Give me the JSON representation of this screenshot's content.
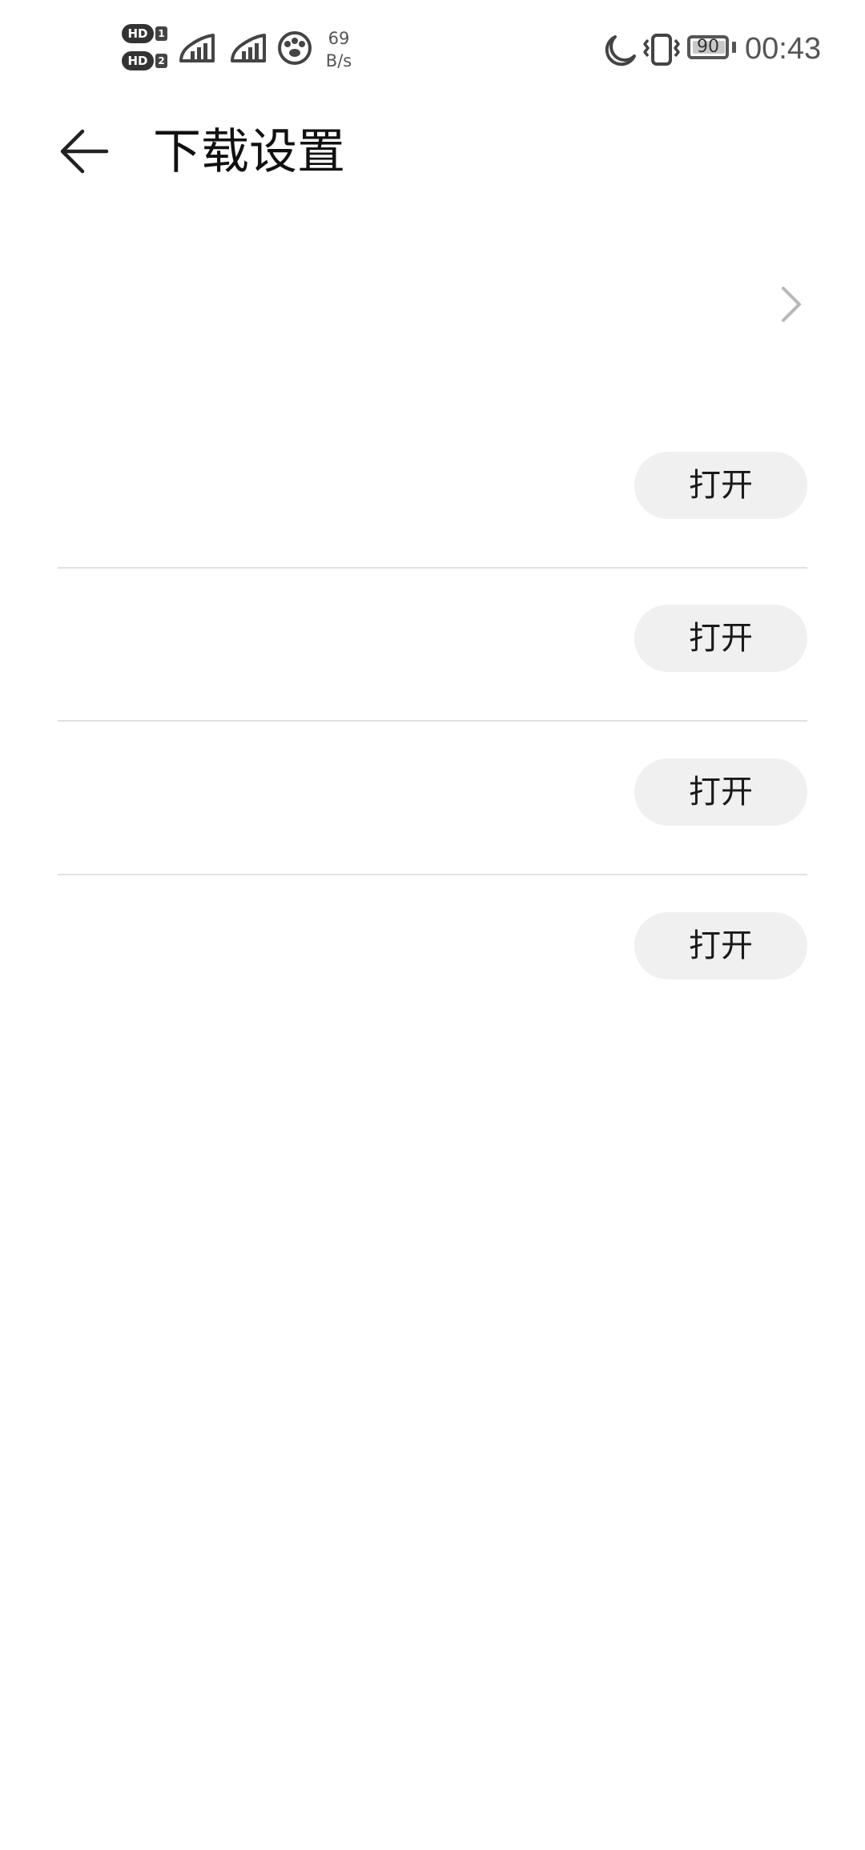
{
  "status_bar": {
    "hd1_label": "HD",
    "hd1_num": "1",
    "hd2_label": "HD",
    "hd2_num": "2",
    "net_speed_value": "69",
    "net_speed_unit": "B/s",
    "battery_level": "90",
    "time": "00:43",
    "icons": [
      "hd-badge",
      "signal-icon",
      "signal-icon",
      "paw-icon",
      "moon-icon",
      "vibrate-icon",
      "battery-icon"
    ]
  },
  "header": {
    "back_icon": "back-arrow-icon",
    "title": "下载设置"
  },
  "nav_row": {
    "label": "",
    "icon": "chevron-right-icon"
  },
  "settings": [
    {
      "label": "",
      "button_label": "打开"
    },
    {
      "label": "",
      "button_label": "打开"
    },
    {
      "label": "",
      "button_label": "打开"
    },
    {
      "label": "",
      "button_label": "打开"
    }
  ],
  "colors": {
    "background": "#ffffff",
    "button_bg": "#f0f0f0",
    "divider": "#e1e1e1",
    "text": "#1a1a1a",
    "secondary": "#555555"
  }
}
